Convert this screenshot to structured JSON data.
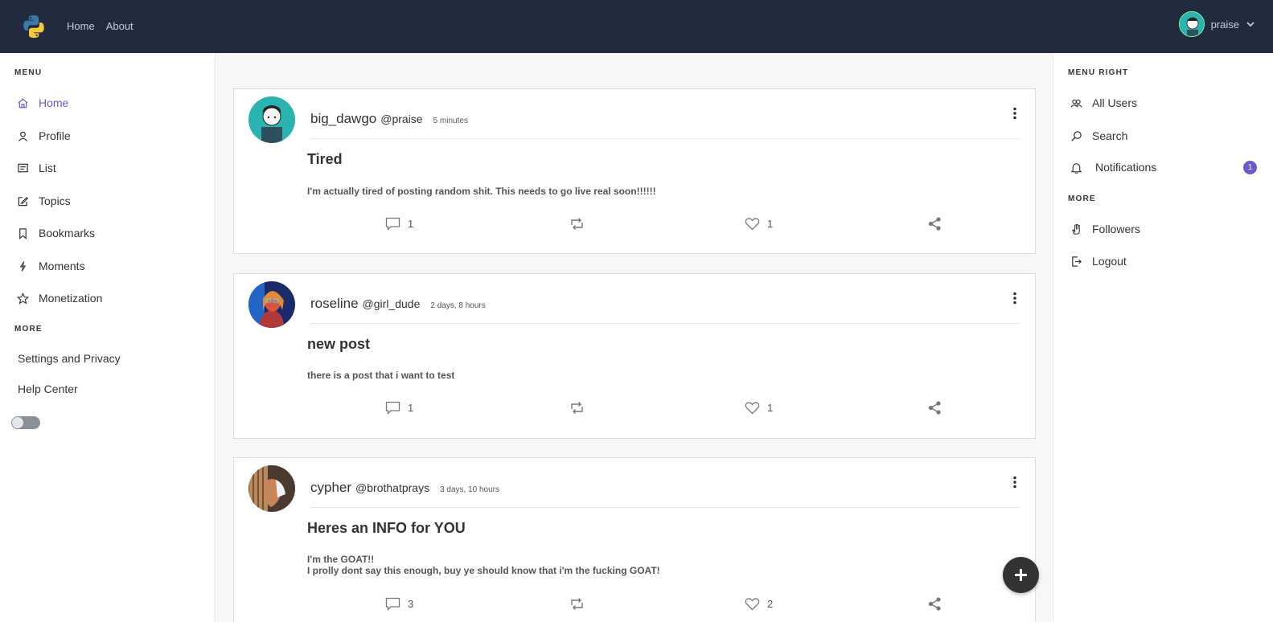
{
  "topnav": {
    "items": [
      "Home",
      "About"
    ],
    "username": "praise"
  },
  "left_menu": {
    "heading": "MENU",
    "items": [
      {
        "label": "Home",
        "icon": "home-icon",
        "active": true
      },
      {
        "label": "Profile",
        "icon": "user-icon"
      },
      {
        "label": "List",
        "icon": "list-icon"
      },
      {
        "label": "Topics",
        "icon": "edit-icon"
      },
      {
        "label": "Bookmarks",
        "icon": "bookmark-icon"
      },
      {
        "label": "Moments",
        "icon": "bolt-icon"
      },
      {
        "label": "Monetization",
        "icon": "star-icon"
      }
    ],
    "more_heading": "MORE",
    "more_items": [
      "Settings and Privacy",
      "Help Center"
    ]
  },
  "right_menu": {
    "heading": "MENU RIGHT",
    "items": [
      {
        "label": "All Users",
        "icon": "users-icon"
      },
      {
        "label": "Search",
        "icon": "search-icon"
      },
      {
        "label": "Notifications",
        "icon": "bell-icon",
        "badge": "1"
      }
    ],
    "more_heading": "MORE",
    "more_items": [
      {
        "label": "Followers",
        "icon": "hand-icon"
      },
      {
        "label": "Logout",
        "icon": "logout-icon"
      }
    ]
  },
  "posts": [
    {
      "name": "big_dawgo",
      "handle": "@praise",
      "time": "5 minutes",
      "title": "Tired",
      "body": [
        "I'm actually tired of posting random shit. This needs to go live real soon!!!!!!"
      ],
      "comments": "1",
      "likes": "1"
    },
    {
      "name": "roseline",
      "handle": "@girl_dude",
      "time": "2 days, 8 hours",
      "title": "new post",
      "body": [
        "there is a post that i want to test"
      ],
      "comments": "1",
      "likes": "1"
    },
    {
      "name": "cypher",
      "handle": "@brothatprays",
      "time": "3 days, 10 hours",
      "title": "Heres an INFO for YOU",
      "body": [
        "I'm the GOAT!!",
        "I prolly dont say this enough, buy ye should know that i'm the fucking GOAT!"
      ],
      "comments": "3",
      "likes": "2"
    }
  ],
  "colors": {
    "topbar": "#222a3d",
    "accent": "#6a5acd"
  }
}
